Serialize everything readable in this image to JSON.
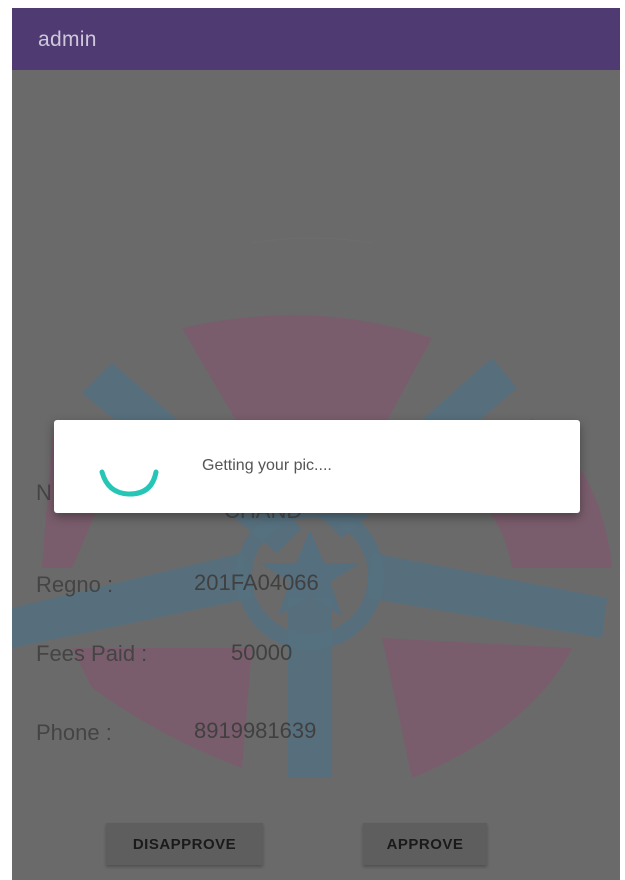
{
  "app_bar": {
    "title": "admin",
    "color": "#4f3b72"
  },
  "background": {
    "logo_icon": "campus-emblem-icon"
  },
  "fields": {
    "name_label_partial": "N",
    "name_value_partial": "CHAND",
    "regno_label": "Regno :",
    "regno_value": "201FA04066",
    "fees_label": "Fees Paid :",
    "fees_value": "50000",
    "phone_label": "Phone :",
    "phone_value": "8919981639"
  },
  "buttons": {
    "disapprove_label": "DISAPPROVE",
    "approve_label": "APPROVE"
  },
  "dialog": {
    "message": "Getting your pic....",
    "spinner_color": "#26c6b7",
    "spinner_icon": "loading-spinner-icon"
  }
}
